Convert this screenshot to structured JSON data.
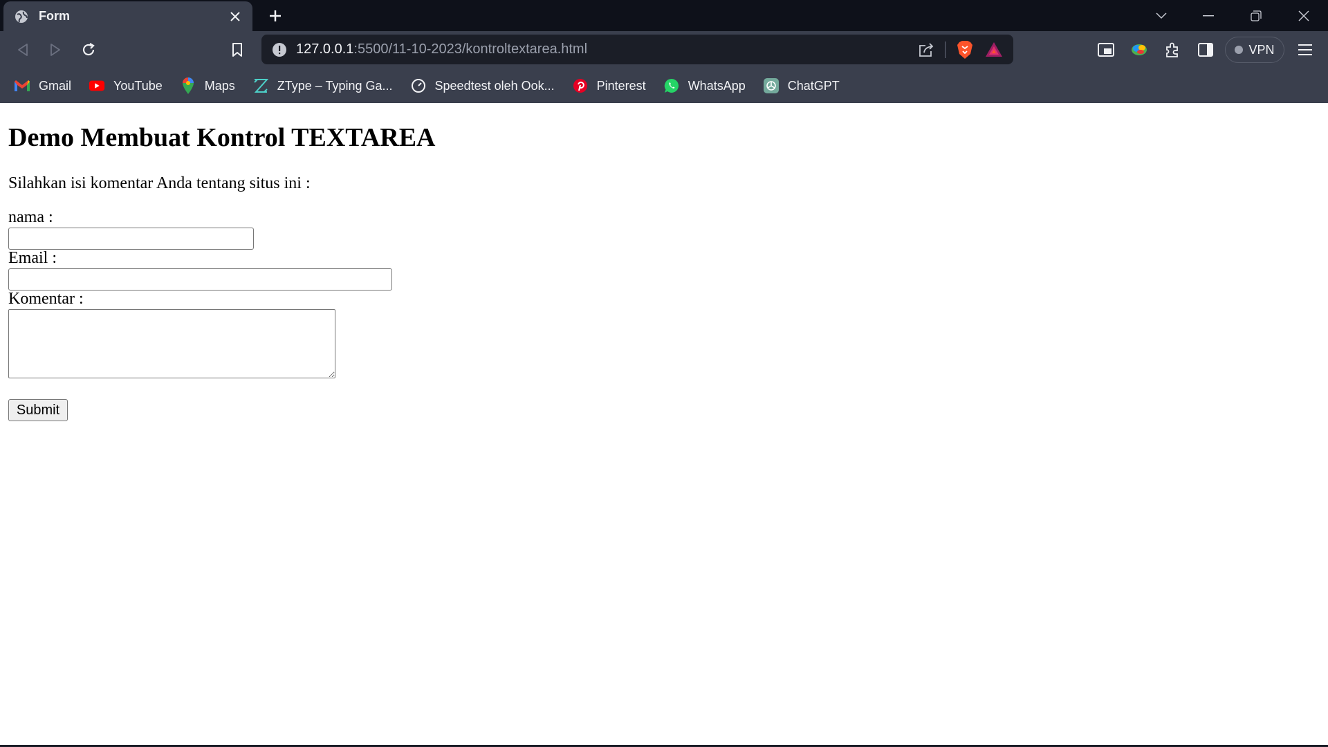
{
  "browser": {
    "tab": {
      "title": "Form",
      "favicon": "globe-icon"
    },
    "url": {
      "host": "127.0.0.1",
      "path": ":5500/11-10-2023/kontroltextarea.html"
    },
    "vpn_label": "VPN",
    "bookmarks": [
      {
        "label": "Gmail",
        "icon": "gmail-icon"
      },
      {
        "label": "YouTube",
        "icon": "youtube-icon"
      },
      {
        "label": "Maps",
        "icon": "maps-icon"
      },
      {
        "label": "ZType – Typing Ga...",
        "icon": "ztype-icon"
      },
      {
        "label": "Speedtest oleh Ook...",
        "icon": "speedtest-icon"
      },
      {
        "label": "Pinterest",
        "icon": "pinterest-icon"
      },
      {
        "label": "WhatsApp",
        "icon": "whatsapp-icon"
      },
      {
        "label": "ChatGPT",
        "icon": "chatgpt-icon"
      }
    ],
    "colors": {
      "tabstrip": "#0e111a",
      "toolbar": "#3a3f4d",
      "urlbar": "#1b1e27"
    }
  },
  "page": {
    "heading": "Demo Membuat Kontrol TEXTAREA",
    "intro": "Silahkan isi komentar Anda tentang situs ini :",
    "form": {
      "nama_label": "nama :",
      "nama_value": "",
      "email_label": "Email :",
      "email_value": "",
      "komentar_label": "Komentar :",
      "komentar_value": "",
      "submit_label": "Submit"
    }
  }
}
